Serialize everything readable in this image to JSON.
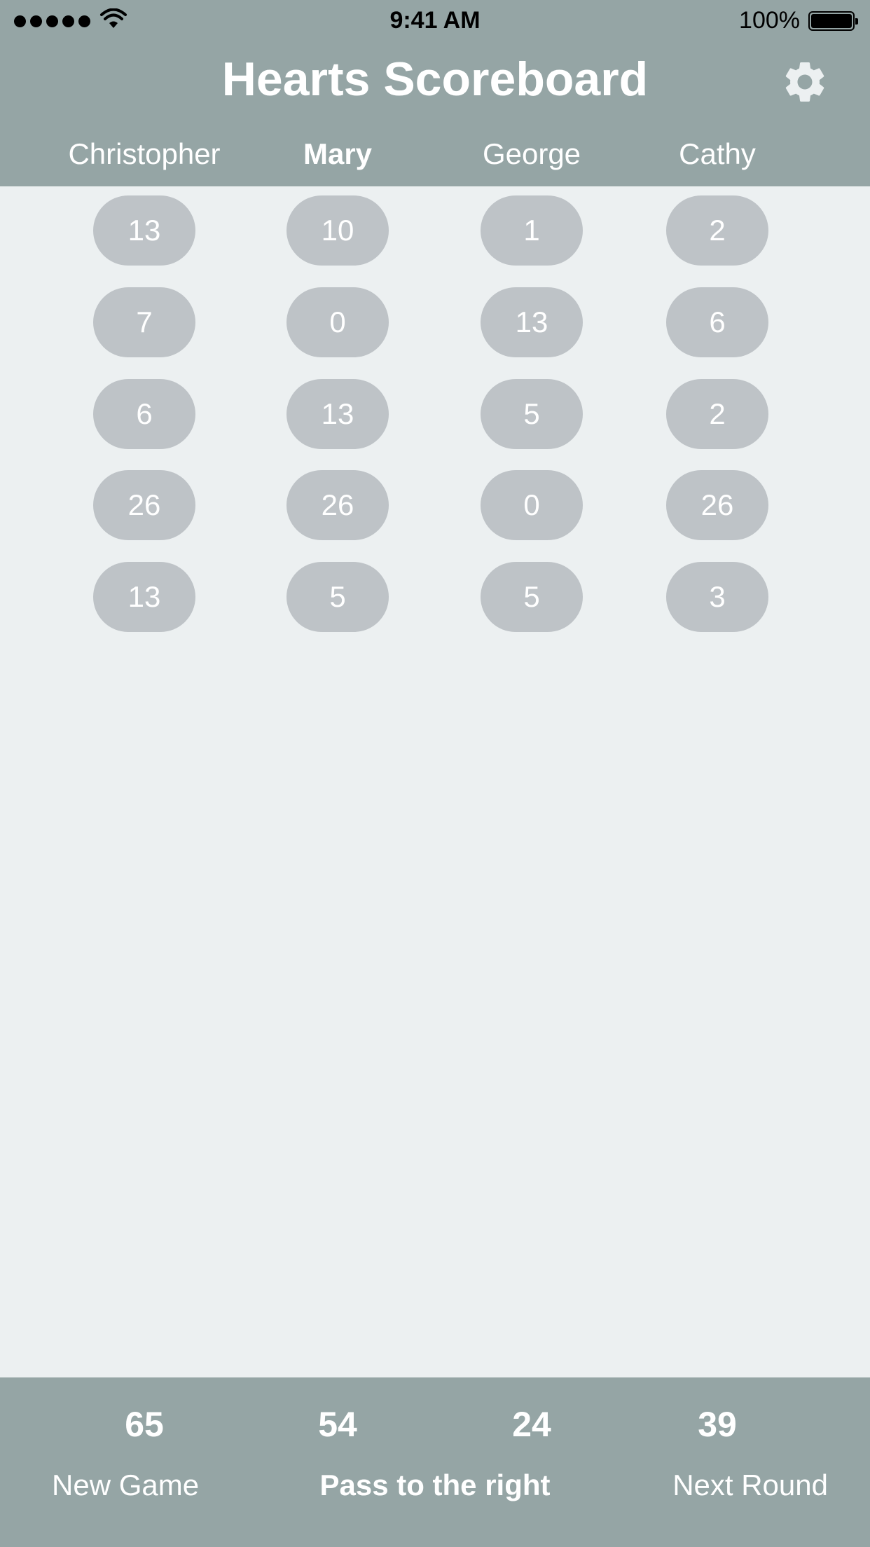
{
  "status_bar": {
    "time": "9:41 AM",
    "battery": "100%"
  },
  "header": {
    "title": "Hearts Scoreboard"
  },
  "players": [
    {
      "name": "Christopher",
      "current": false
    },
    {
      "name": "Mary",
      "current": true
    },
    {
      "name": "George",
      "current": false
    },
    {
      "name": "Cathy",
      "current": false
    }
  ],
  "rounds": [
    [
      "13",
      "10",
      "1",
      "2"
    ],
    [
      "7",
      "0",
      "13",
      "6"
    ],
    [
      "6",
      "13",
      "5",
      "2"
    ],
    [
      "26",
      "26",
      "0",
      "26"
    ],
    [
      "13",
      "5",
      "5",
      "3"
    ]
  ],
  "totals": [
    "65",
    "54",
    "24",
    "39"
  ],
  "footer": {
    "new_game": "New Game",
    "pass": "Pass to the right",
    "next_round": "Next Round"
  },
  "colors": {
    "bar": "#95A5A5",
    "background": "#ECF0F1",
    "pill": "#BEC3C7",
    "text": "#FFFFFF"
  }
}
